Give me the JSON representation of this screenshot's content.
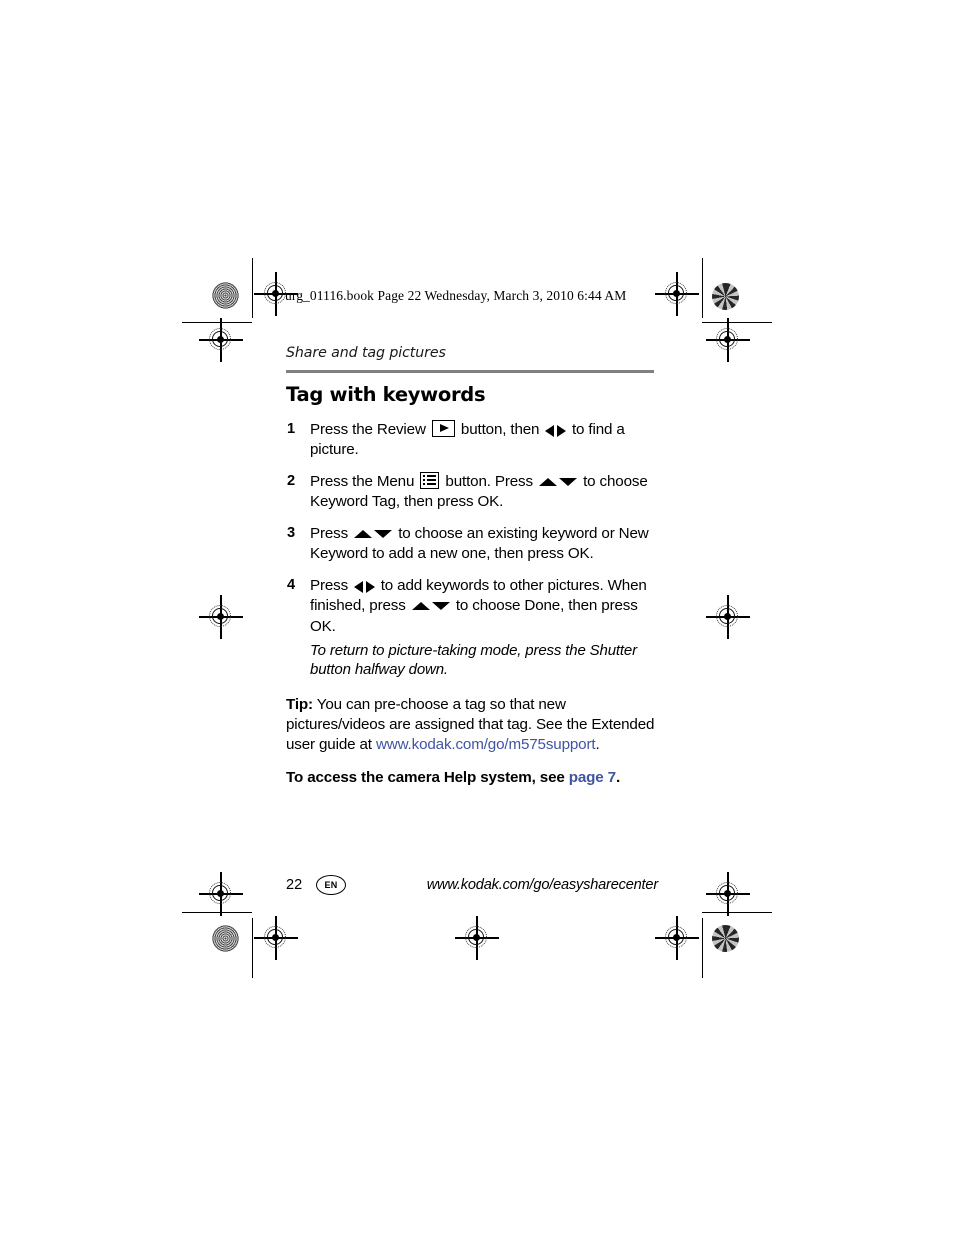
{
  "slug": "urg_01116.book  Page 22  Wednesday, March 3, 2010  6:44 AM",
  "running_head": "Share and tag pictures",
  "section_title": "Tag with keywords",
  "colors": {
    "link": "#4054a4",
    "rule": "#808080",
    "text": "#000000"
  },
  "steps": [
    {
      "number": "1",
      "parts": [
        {
          "type": "text",
          "value": "Press the Review "
        },
        {
          "type": "icon",
          "name": "review-button-icon"
        },
        {
          "type": "text",
          "value": " button, then "
        },
        {
          "type": "icon",
          "name": "left-right-arrows-icon"
        },
        {
          "type": "text",
          "value": " to find a picture."
        }
      ]
    },
    {
      "number": "2",
      "parts": [
        {
          "type": "text",
          "value": "Press the Menu "
        },
        {
          "type": "icon",
          "name": "menu-button-icon"
        },
        {
          "type": "text",
          "value": " button. Press "
        },
        {
          "type": "icon",
          "name": "up-down-arrows-icon"
        },
        {
          "type": "text",
          "value": " to choose Keyword Tag, then press OK."
        }
      ]
    },
    {
      "number": "3",
      "parts": [
        {
          "type": "text",
          "value": "Press "
        },
        {
          "type": "icon",
          "name": "up-down-arrows-icon"
        },
        {
          "type": "text",
          "value": " to choose an existing keyword or New Keyword to add a new one, then press OK."
        }
      ]
    },
    {
      "number": "4",
      "parts": [
        {
          "type": "text",
          "value": "Press "
        },
        {
          "type": "icon",
          "name": "left-right-arrows-icon"
        },
        {
          "type": "text",
          "value": " to add keywords to other pictures. When finished, press "
        },
        {
          "type": "icon",
          "name": "up-down-arrows-icon"
        },
        {
          "type": "text",
          "value": " to choose Done, then press OK."
        }
      ]
    }
  ],
  "note": "To return to picture-taking mode, press the Shutter button halfway down.",
  "tip": {
    "label": "Tip:",
    "body_before_link": " You can pre-choose a tag so that new pictures/videos are assigned that tag. See the Extended user guide at ",
    "link_text": "www.kodak.com/go/m575support",
    "body_after_link": "."
  },
  "help_line": {
    "text_before_link": "To access the camera Help system, see ",
    "link_text": "page 7",
    "text_after_link": "."
  },
  "footer": {
    "page_number": "22",
    "language_badge": "EN",
    "url": "www.kodak.com/go/easysharecenter"
  }
}
